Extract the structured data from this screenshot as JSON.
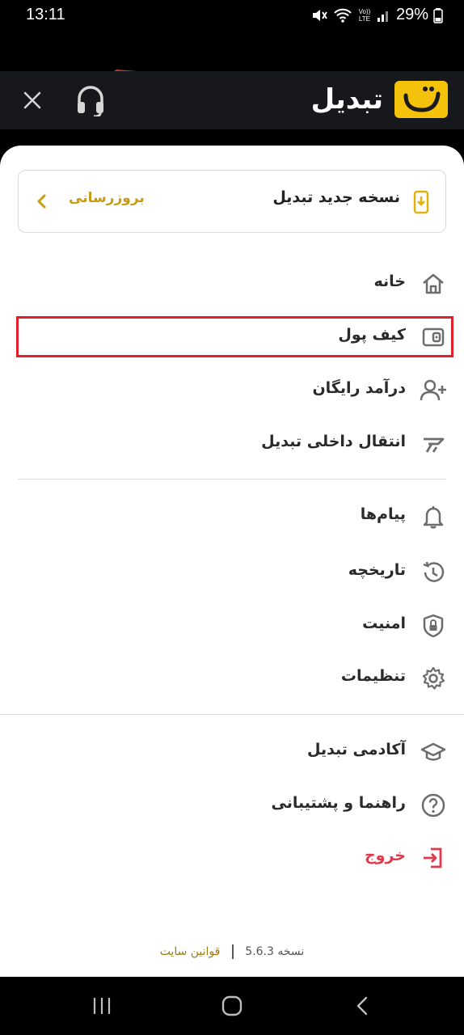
{
  "status_bar": {
    "time": "13:11",
    "volte_label": "Vo)) LTE",
    "battery_percent": "29%"
  },
  "header": {
    "app_name": "تبدیل",
    "support_icon": "headset-icon",
    "close_icon": "close-icon"
  },
  "update_card": {
    "title": "نسخه جدید تبدیل",
    "action": "بروزرسانی"
  },
  "menu": {
    "group1": [
      {
        "label": "خانه",
        "icon": "home-icon"
      },
      {
        "label": "کیف پول",
        "icon": "wallet-icon"
      },
      {
        "label": "درآمد رایگان",
        "icon": "add-user-icon"
      },
      {
        "label": "انتقال داخلی تبدیل",
        "icon": "transfer-icon"
      }
    ],
    "group2": [
      {
        "label": "پیام‌ها",
        "icon": "bell-icon"
      },
      {
        "label": "تاریخچه",
        "icon": "history-icon"
      },
      {
        "label": "امنیت",
        "icon": "shield-lock-icon"
      },
      {
        "label": "تنظیمات",
        "icon": "gear-icon"
      }
    ],
    "group3": [
      {
        "label": "آکادمی تبدیل",
        "icon": "graduation-cap-icon"
      },
      {
        "label": "راهنما و پشتیبانی",
        "icon": "help-circle-icon"
      },
      {
        "label": "خروج",
        "icon": "logout-icon"
      }
    ]
  },
  "footer": {
    "version": "نسخه 5.6.3",
    "rules_link": "قوانین سایت"
  },
  "colors": {
    "brand_yellow": "#f5c20b",
    "accent_gold": "#c89c10",
    "danger_red": "#e03a4a",
    "highlight_red": "#e0202d"
  }
}
